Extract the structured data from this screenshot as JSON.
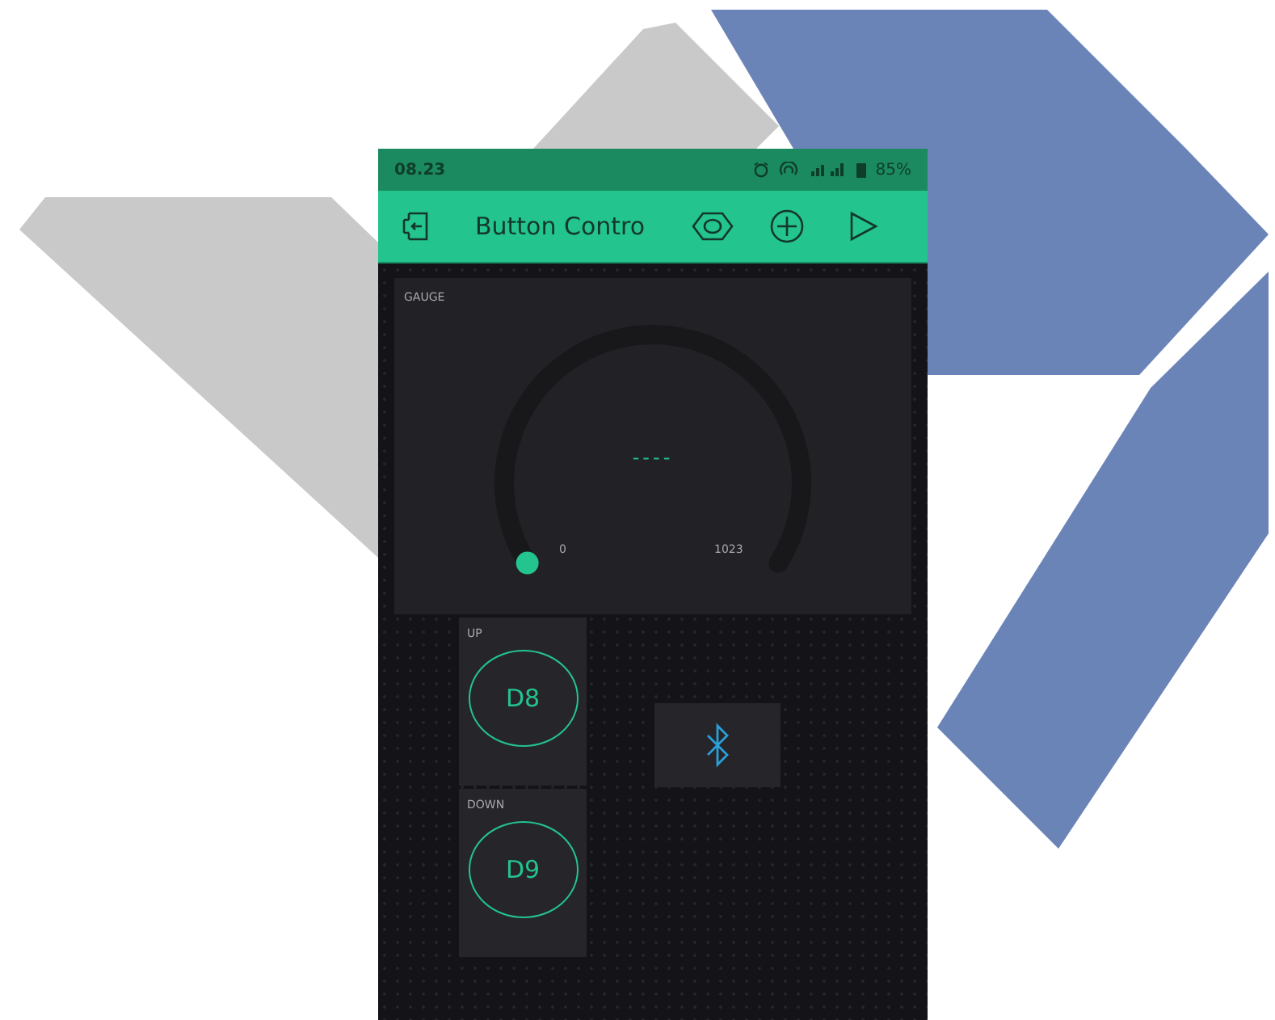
{
  "status_bar": {
    "time": "08.23",
    "battery": "85%"
  },
  "toolbar": {
    "title": "Button Contro"
  },
  "gauge": {
    "label": "GAUGE",
    "value": "----",
    "min": "0",
    "max": "1023",
    "level": 0
  },
  "buttons": [
    {
      "label": "UP",
      "pin": "D8"
    },
    {
      "label": "DOWN",
      "pin": "D9"
    }
  ],
  "bluetooth": {
    "kind": "bluetooth"
  }
}
